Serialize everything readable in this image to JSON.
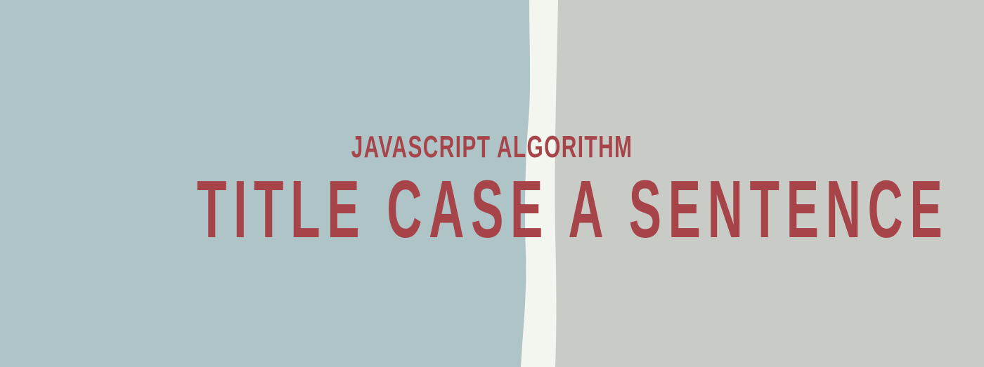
{
  "banner": {
    "subtitle": "JAVASCRIPT ALGORITHM",
    "title": "TITLE CASE A SENTENCE"
  },
  "colors": {
    "left_panel": "#aec4c6",
    "divider_stripe": "#f3f6ee",
    "right_panel": "#c9ccc6",
    "text": "#a7444a"
  }
}
